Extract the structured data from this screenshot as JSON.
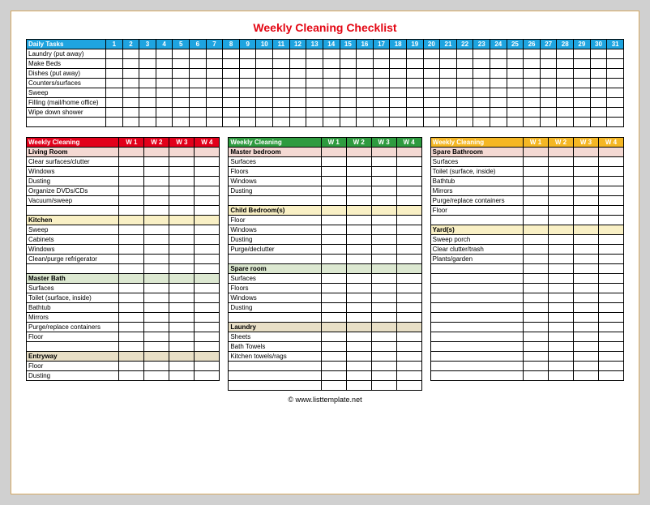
{
  "title": "Weekly Cleaning Checklist",
  "footer": "© www.listtemplate.net",
  "daily": {
    "header_label": "Daily Tasks",
    "days": [
      "1",
      "2",
      "3",
      "4",
      "5",
      "6",
      "7",
      "8",
      "9",
      "10",
      "11",
      "12",
      "13",
      "14",
      "15",
      "16",
      "17",
      "18",
      "19",
      "20",
      "21",
      "22",
      "23",
      "24",
      "25",
      "26",
      "27",
      "28",
      "29",
      "30",
      "31"
    ],
    "tasks": [
      "Laundry (put away)",
      "Make Beds",
      "Dishes (put away)",
      "Counters/surfaces",
      "Sweep",
      "Filling (mail/home office)",
      "Wipe down shower",
      ""
    ]
  },
  "weekly_header": {
    "label": "Weekly Cleaning",
    "weeks": [
      "W 1",
      "W 2",
      "W 3",
      "W 4"
    ]
  },
  "col_red": {
    "sections": [
      {
        "name": "Living Room",
        "class": "sec-pink",
        "tasks": [
          "Clear surfaces/clutter",
          "Windows",
          "Dusting",
          "Organize DVDs/CDs",
          "Vacuum/sweep",
          ""
        ]
      },
      {
        "name": "Kitchen",
        "class": "sec-yellow",
        "tasks": [
          "Sweep",
          "Cabinets",
          "Windows",
          "Clean/purge refrigerator",
          ""
        ]
      },
      {
        "name": "Master Bath",
        "class": "sec-green",
        "tasks": [
          "Surfaces",
          "Toilet (surface, inside)",
          "Bathtub",
          "Mirrors",
          "Purge/replace containers",
          "Floor",
          ""
        ]
      },
      {
        "name": "Entryway",
        "class": "sec-tan",
        "tasks": [
          "Floor",
          "Dusting"
        ]
      }
    ]
  },
  "col_green": {
    "sections": [
      {
        "name": "Master bedroom",
        "class": "sec-pink",
        "tasks": [
          "Surfaces",
          "Floors",
          "Windows",
          "Dusting",
          ""
        ]
      },
      {
        "name": "Child Bedroom(s)",
        "class": "sec-yellow",
        "tasks": [
          "Floor",
          "Windows",
          "Dusting",
          "Purge/declutter",
          ""
        ]
      },
      {
        "name": "Spare room",
        "class": "sec-green",
        "tasks": [
          "Surfaces",
          "Floors",
          "Windows",
          "Dusting",
          ""
        ]
      },
      {
        "name": "Laundry",
        "class": "sec-tan",
        "tasks": [
          "Sheets",
          "Bath Towels",
          "Kitchen towels/rags"
        ]
      }
    ],
    "trailing_blanks": 3
  },
  "col_orange": {
    "sections": [
      {
        "name": "Spare Bathroom",
        "class": "sec-pink",
        "tasks": [
          "Surfaces",
          "Toilet (surface, inside)",
          "Bathtub",
          "Mirrors",
          "Purge/replace containers",
          "Floor",
          ""
        ]
      },
      {
        "name": "Yard(s)",
        "class": "sec-yellow",
        "tasks": [
          "Sweep porch",
          "Clear clutter/trash",
          "Plants/garden"
        ]
      }
    ],
    "trailing_blanks": 12
  }
}
